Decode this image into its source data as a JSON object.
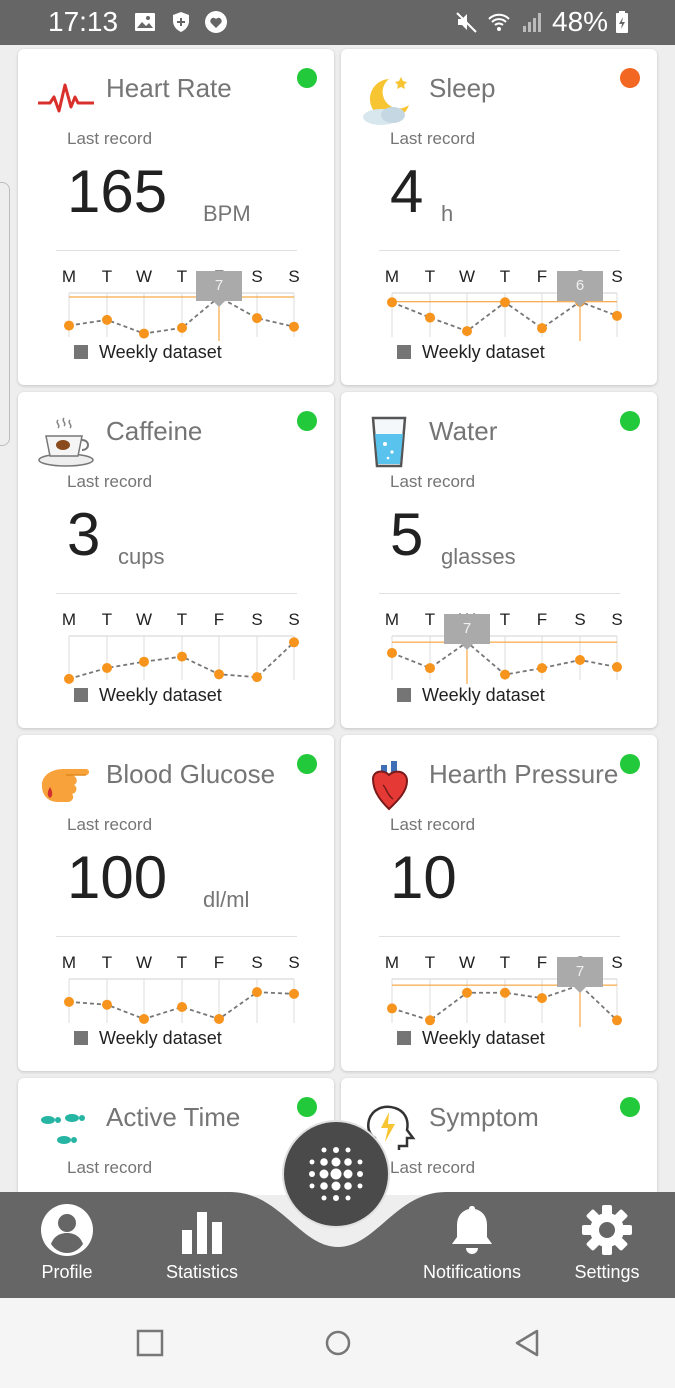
{
  "status_bar": {
    "time": "17:13",
    "battery": "48%",
    "icons": [
      "image-icon",
      "shield-icon",
      "heart-icon",
      "mute-icon",
      "wifi-icon",
      "signal-icon",
      "battery-icon"
    ]
  },
  "colors": {
    "status_green": "#22c93a",
    "status_orange": "#f26722",
    "chart_orange": "#f7941d",
    "nav_bg": "#666666"
  },
  "days": [
    "M",
    "T",
    "W",
    "T",
    "F",
    "S",
    "S"
  ],
  "cards": [
    {
      "title": "Heart Rate",
      "icon": "heart-rate-icon",
      "status": "green",
      "last_record_label": "Last record",
      "value": "165",
      "unit": "BPM",
      "legend": "Weekly dataset",
      "chart": {
        "values": [
          2.0,
          3.0,
          0.6,
          1.6,
          7,
          3.3,
          1.8
        ],
        "ylim": [
          0,
          7
        ],
        "highlight_index": 4,
        "tooltip": "7"
      }
    },
    {
      "title": "Sleep",
      "icon": "moon-cloud-icon",
      "status": "orange",
      "last_record_label": "Last record",
      "value": "4",
      "unit": "h",
      "legend": "Weekly dataset",
      "chart": {
        "values": [
          5.9,
          3.3,
          1.0,
          5.9,
          1.5,
          6,
          3.6
        ],
        "ylim": [
          0,
          6.8
        ],
        "highlight_index": 5,
        "tooltip": "6"
      }
    },
    {
      "title": "Caffeine",
      "icon": "coffee-cup-icon",
      "status": "green",
      "last_record_label": "Last record",
      "value": "3",
      "unit": "cups",
      "legend": "Weekly dataset",
      "chart": {
        "values": [
          0.2,
          2.1,
          3.2,
          4.1,
          1.0,
          0.5,
          6.6
        ],
        "ylim": [
          0,
          7
        ]
      }
    },
    {
      "title": "Water",
      "icon": "water-glass-icon",
      "status": "green",
      "last_record_label": "Last record",
      "value": "5",
      "unit": "glasses",
      "legend": "Weekly dataset",
      "chart": {
        "values": [
          5.0,
          2.2,
          7,
          1.0,
          2.2,
          3.7,
          2.4
        ],
        "ylim": [
          0,
          7.4
        ],
        "highlight_index": 2,
        "tooltip": "7"
      }
    },
    {
      "title": "Blood Glucose",
      "icon": "finger-prick-icon",
      "status": "green",
      "last_record_label": "Last record",
      "value": "100",
      "unit": "dl/ml",
      "legend": "Weekly dataset",
      "chart": {
        "values": [
          3.7,
          3.2,
          0.7,
          2.8,
          0.7,
          5.4,
          5.1
        ],
        "ylim": [
          0,
          7
        ]
      }
    },
    {
      "title": "Hearth Pressure",
      "icon": "anatomical-heart-icon",
      "status": "green",
      "last_record_label": "Last record",
      "value": "10",
      "unit": "",
      "legend": "Weekly dataset",
      "chart": {
        "values": [
          2.7,
          0.5,
          5.6,
          5.6,
          4.6,
          7,
          0.5
        ],
        "ylim": [
          0,
          7.4
        ],
        "highlight_index": 5,
        "tooltip": "7"
      }
    },
    {
      "title": "Active Time",
      "icon": "footsteps-icon",
      "status": "green",
      "last_record_label": "Last record",
      "value": "",
      "unit": "",
      "legend": "",
      "chart": null
    },
    {
      "title": "Symptom",
      "icon": "head-lightning-icon",
      "status": "green",
      "last_record_label": "Last record",
      "value": "",
      "unit": "",
      "legend": "",
      "chart": null
    }
  ],
  "nav": {
    "items": [
      {
        "label": "Profile",
        "icon": "profile-icon"
      },
      {
        "label": "Statistics",
        "icon": "bar-chart-icon"
      },
      {
        "label": "Notifications",
        "icon": "bell-icon"
      },
      {
        "label": "Settings",
        "icon": "gear-icon"
      }
    ],
    "fab_icon": "dots-grid-icon"
  },
  "system_nav": [
    "recent-apps-icon",
    "home-icon",
    "back-icon"
  ]
}
